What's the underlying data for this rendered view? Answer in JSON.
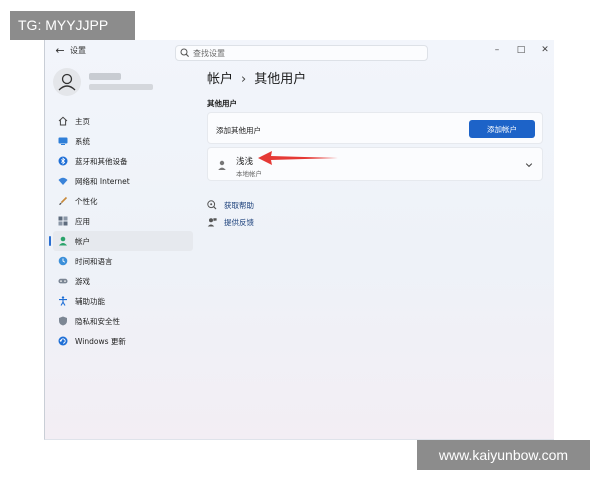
{
  "watermarks": {
    "top_left": "TG: MYYJJPP",
    "bottom_right": "www.kaiyunbow.com"
  },
  "window": {
    "title": "设置",
    "controls": {
      "minimize": "–",
      "maximize": "□",
      "close": "✕"
    }
  },
  "search": {
    "placeholder": "查找设置"
  },
  "sidebar": {
    "items": [
      {
        "label": "主页",
        "icon": "home-icon"
      },
      {
        "label": "系统",
        "icon": "monitor-icon"
      },
      {
        "label": "蓝牙和其他设备",
        "icon": "bluetooth-icon"
      },
      {
        "label": "网络和 Internet",
        "icon": "wifi-icon"
      },
      {
        "label": "个性化",
        "icon": "brush-icon"
      },
      {
        "label": "应用",
        "icon": "apps-icon"
      },
      {
        "label": "帐户",
        "icon": "person-icon",
        "active": true
      },
      {
        "label": "时间和语言",
        "icon": "globe-clock-icon"
      },
      {
        "label": "游戏",
        "icon": "gamepad-icon"
      },
      {
        "label": "辅助功能",
        "icon": "accessibility-icon"
      },
      {
        "label": "隐私和安全性",
        "icon": "shield-icon"
      },
      {
        "label": "Windows 更新",
        "icon": "update-icon"
      }
    ]
  },
  "breadcrumb": {
    "parent": "帐户",
    "separator": "›",
    "current": "其他用户"
  },
  "section": {
    "label": "其他用户"
  },
  "add_user": {
    "label": "添加其他用户",
    "button": "添加帐户"
  },
  "user": {
    "name": "浅浅",
    "type": "本地帐户"
  },
  "links": {
    "help": "获取帮助",
    "feedback": "提供反馈"
  },
  "colors": {
    "accent": "#1d63c8",
    "annotation_arrow": "#e53935"
  }
}
